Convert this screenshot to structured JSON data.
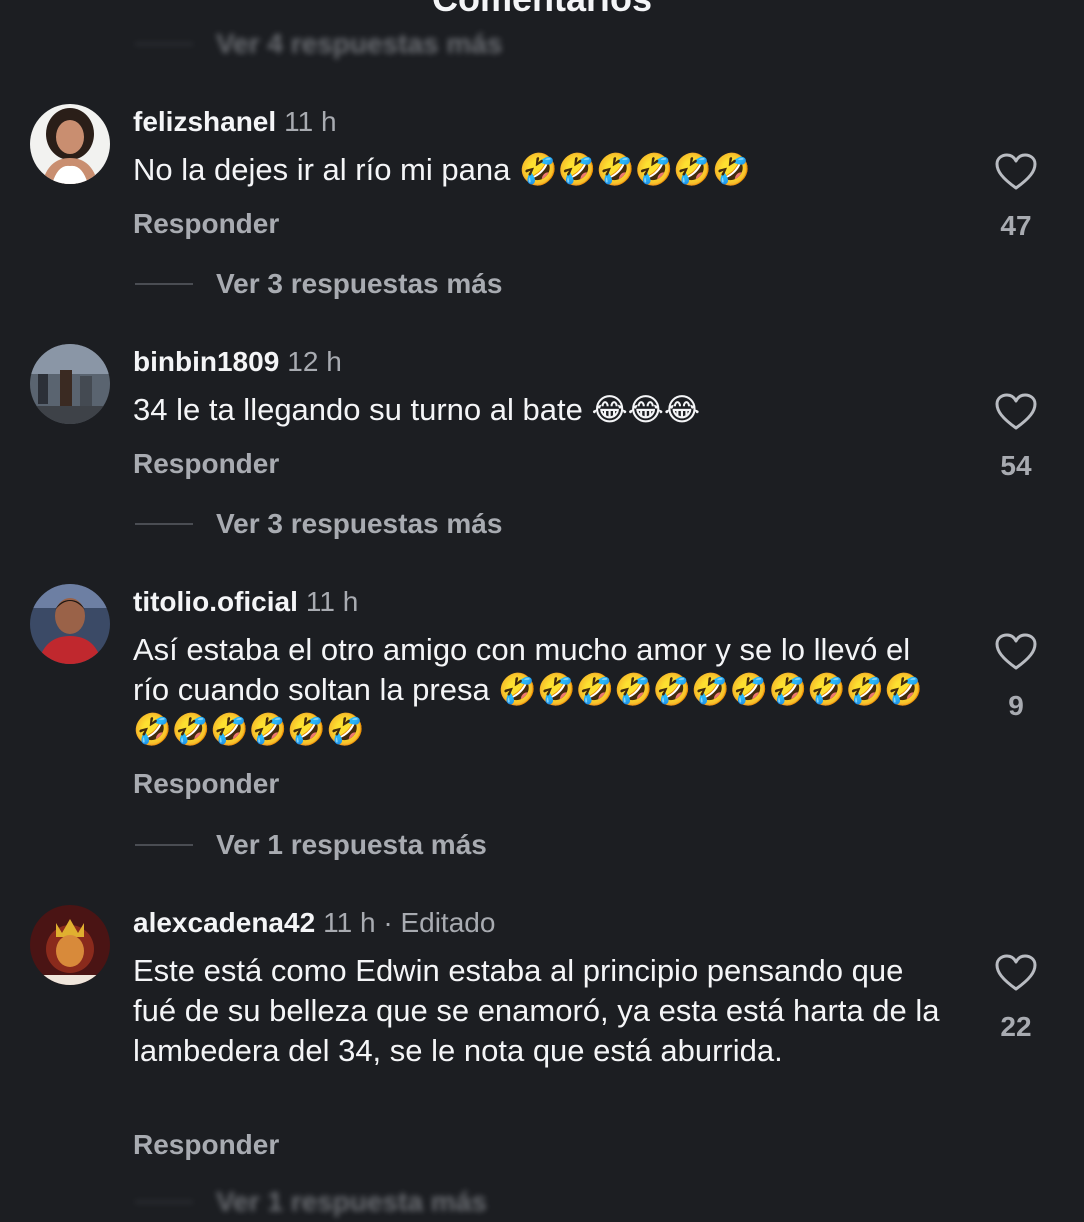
{
  "header": {
    "title": "Comentarios"
  },
  "top_replies": {
    "label": "Ver 4 respuestas más"
  },
  "comments": [
    {
      "username": "felizshanel",
      "time": "11 h",
      "text": "No la dejes ir al río mi pana 🤣🤣🤣🤣🤣🤣",
      "reply_label": "Responder",
      "likes": "47",
      "replies_label": "Ver 3 respuestas más",
      "avatar_icon": "profile-photo"
    },
    {
      "username": "binbin1809",
      "time": "12 h",
      "text": "34 le ta llegando su turno al bate 😂😂😂",
      "reply_label": "Responder",
      "likes": "54",
      "replies_label": "Ver 3 respuestas más",
      "avatar_icon": "profile-photo"
    },
    {
      "username": "titolio.oficial",
      "time": "11 h",
      "text": "Así estaba el otro amigo con mucho amor y se lo llevó el río cuando soltan la presa 🤣🤣🤣🤣🤣🤣🤣🤣🤣🤣🤣🤣🤣🤣🤣🤣🤣",
      "reply_label": "Responder",
      "likes": "9",
      "replies_label": "Ver 1 respuesta más",
      "avatar_icon": "profile-photo"
    },
    {
      "username": "alexcadena42",
      "time": "11 h · Editado",
      "text": "Este está como Edwin estaba al principio pensando que fué de su belleza que se enamoró, ya esta está harta de la lambedera del 34, se le nota que está aburrida.",
      "reply_label": "Responder",
      "likes": "22",
      "replies_label": "Ver 1 respuesta más",
      "avatar_icon": "profile-photo"
    }
  ],
  "colors": {
    "background": "#1c1e22",
    "primary_text": "#f4f5f7",
    "secondary_text": "#a8abb1"
  },
  "icons": {
    "like": "heart-outline-icon"
  }
}
